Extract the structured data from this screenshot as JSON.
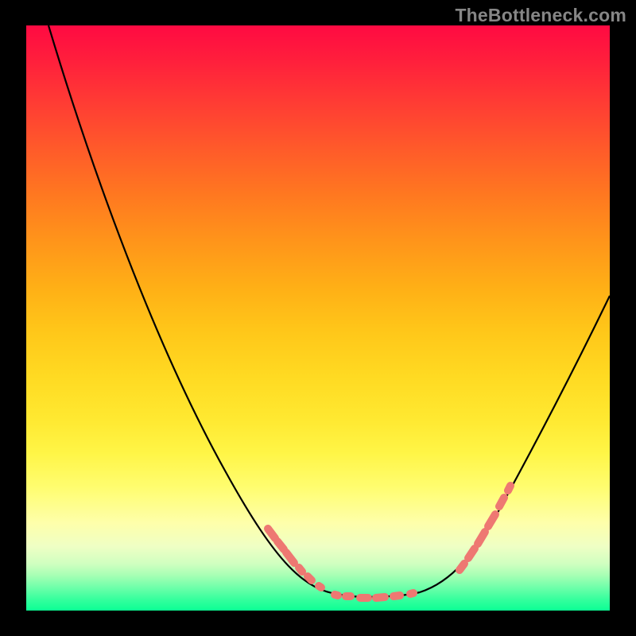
{
  "watermark": "TheBottleneck.com",
  "chart_data": {
    "type": "line",
    "title": "",
    "xlabel": "",
    "ylabel": "",
    "xlim": [
      0,
      100
    ],
    "ylim": [
      0,
      100
    ],
    "series": [
      {
        "name": "curve",
        "x": [
          4,
          10,
          20,
          30,
          35,
          40,
          45,
          50,
          54,
          58,
          62,
          67,
          72,
          78,
          85,
          92,
          100
        ],
        "y": [
          100,
          80,
          55,
          35,
          25,
          16,
          10,
          6,
          3,
          2,
          2,
          3,
          6,
          12,
          22,
          36,
          54
        ]
      }
    ],
    "highlight_x_ranges": [
      [
        41,
        51
      ],
      [
        53,
        67
      ],
      [
        74,
        83
      ]
    ],
    "background_gradient": {
      "top": "#ff0a42",
      "bottom": "#0bff94"
    }
  }
}
